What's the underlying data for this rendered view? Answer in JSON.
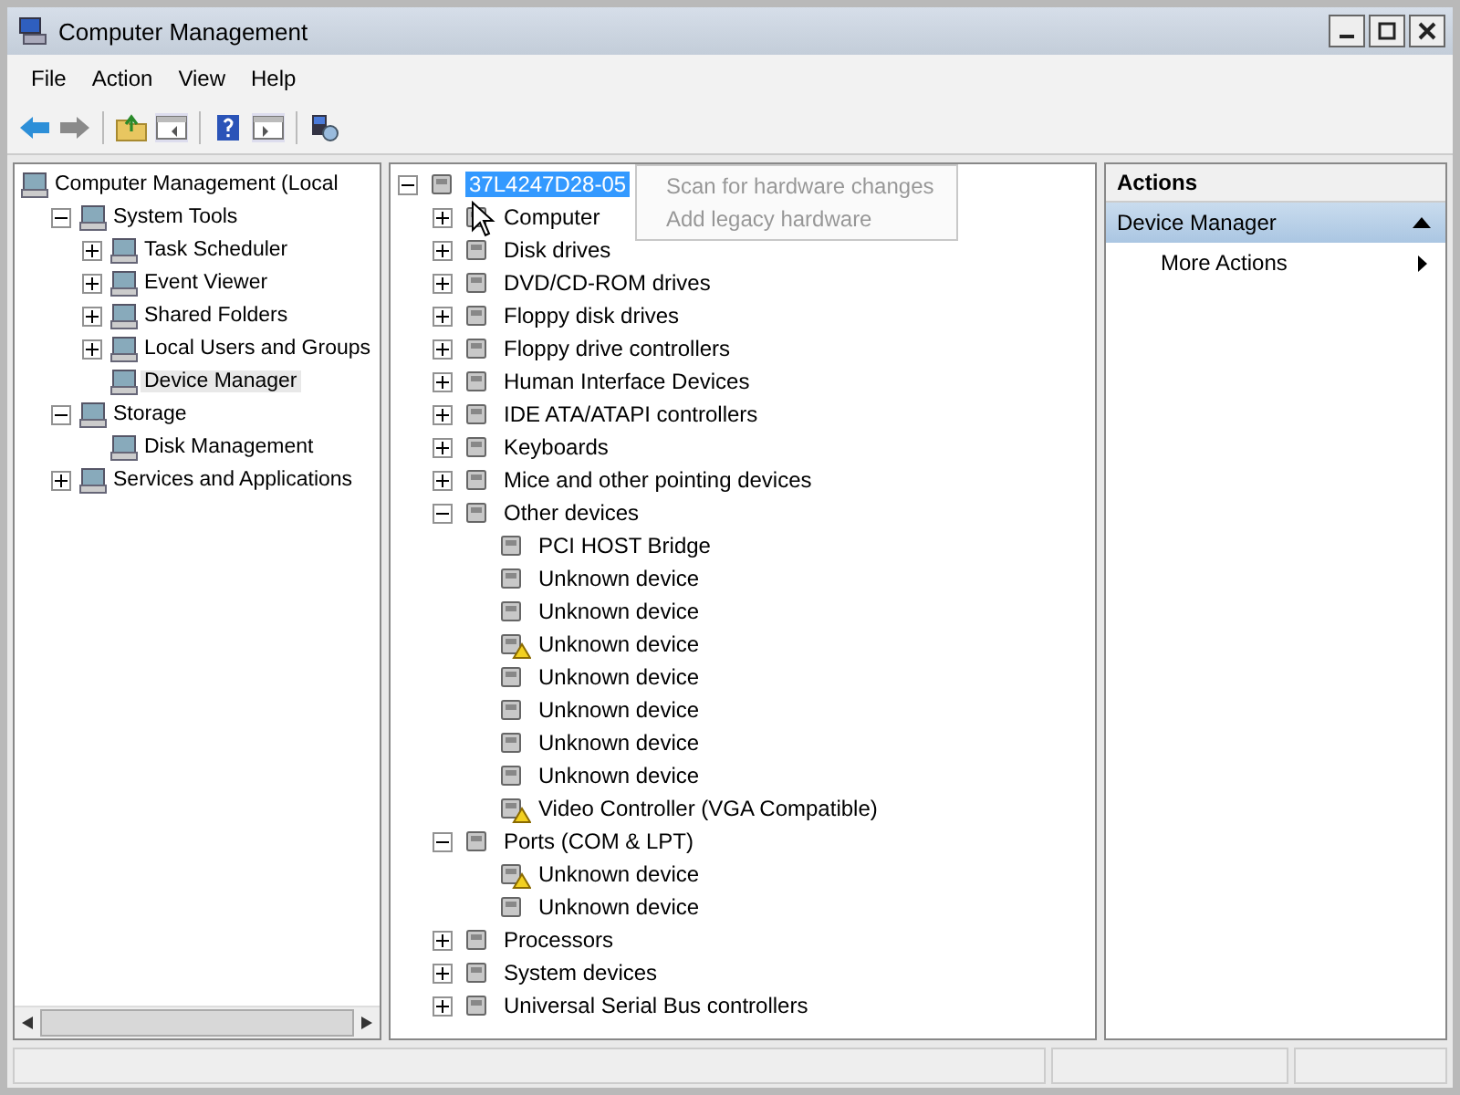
{
  "window": {
    "title": "Computer Management"
  },
  "menu": [
    "File",
    "Action",
    "View",
    "Help"
  ],
  "nav_tree": [
    {
      "label": "Computer Management (Local",
      "selected": false,
      "children": [
        {
          "label": "System Tools",
          "expanded": true,
          "selected": false,
          "children": [
            {
              "label": "Task Scheduler",
              "expanded": false,
              "selected": false
            },
            {
              "label": "Event Viewer",
              "expanded": false,
              "selected": false
            },
            {
              "label": "Shared Folders",
              "expanded": false,
              "selected": false
            },
            {
              "label": "Local Users and Groups",
              "expanded": false,
              "selected": false
            },
            {
              "label": "Device Manager",
              "selected": true
            }
          ]
        },
        {
          "label": "Storage",
          "expanded": true,
          "selected": false,
          "children": [
            {
              "label": "Disk Management",
              "selected": false
            }
          ]
        },
        {
          "label": "Services and Applications",
          "expanded": false,
          "selected": false
        }
      ]
    }
  ],
  "device_tree": [
    {
      "label": "37L4247D28-05",
      "expanded": true,
      "selected": true,
      "children": [
        {
          "label": "Computer",
          "expanded": false,
          "selected": false
        },
        {
          "label": "Disk drives",
          "expanded": false,
          "selected": false
        },
        {
          "label": "DVD/CD-ROM drives",
          "expanded": false,
          "selected": false
        },
        {
          "label": "Floppy disk drives",
          "expanded": false,
          "selected": false
        },
        {
          "label": "Floppy drive controllers",
          "expanded": false,
          "selected": false
        },
        {
          "label": "Human Interface Devices",
          "expanded": false,
          "selected": false
        },
        {
          "label": "IDE ATA/ATAPI controllers",
          "expanded": false,
          "selected": false
        },
        {
          "label": "Keyboards",
          "expanded": false,
          "selected": false
        },
        {
          "label": "Mice and other pointing devices",
          "expanded": false,
          "selected": false
        },
        {
          "label": "Other devices",
          "expanded": true,
          "selected": false,
          "children": [
            {
              "label": "PCI HOST Bridge",
              "warning": false,
              "selected": false
            },
            {
              "label": "Unknown device",
              "warning": false,
              "selected": false
            },
            {
              "label": "Unknown device",
              "warning": false,
              "selected": false
            },
            {
              "label": "Unknown device",
              "warning": true,
              "selected": false
            },
            {
              "label": "Unknown device",
              "warning": false,
              "selected": false
            },
            {
              "label": "Unknown device",
              "warning": false,
              "selected": false
            },
            {
              "label": "Unknown device",
              "warning": false,
              "selected": false
            },
            {
              "label": "Unknown device",
              "warning": false,
              "selected": false
            },
            {
              "label": "Video Controller (VGA Compatible)",
              "warning": true,
              "selected": false
            }
          ]
        },
        {
          "label": "Ports (COM & LPT)",
          "expanded": true,
          "selected": false,
          "children": [
            {
              "label": "Unknown device",
              "warning": true,
              "selected": false
            },
            {
              "label": "Unknown device",
              "warning": false,
              "selected": false
            }
          ]
        },
        {
          "label": "Processors",
          "expanded": false,
          "selected": false
        },
        {
          "label": "System devices",
          "expanded": false,
          "selected": false
        },
        {
          "label": "Universal Serial Bus controllers",
          "expanded": false,
          "selected": false
        }
      ]
    }
  ],
  "context_menu": {
    "items": [
      "Scan for hardware changes",
      "Add legacy hardware"
    ]
  },
  "actions": {
    "title": "Actions",
    "section": "Device Manager",
    "items": [
      "More Actions"
    ]
  }
}
